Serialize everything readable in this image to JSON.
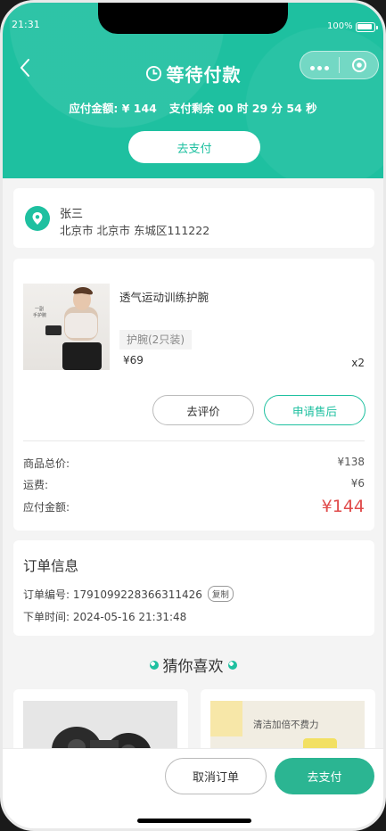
{
  "status_bar": {
    "time": "21:31",
    "battery": "100%"
  },
  "header": {
    "title": "等待付款",
    "amount_label": "应付金额: ¥ 144",
    "countdown_label": "支付剩余 00 时 29 分 54 秒",
    "pay_button": "去支付",
    "accent_color": "#1ec0a0"
  },
  "address": {
    "name": "张三",
    "detail": "北京市 北京市 东城区111222"
  },
  "goods": {
    "name": "透气运动训练护腕",
    "spec": "护腕(2只装)",
    "price": "¥69",
    "qty": "x2",
    "thumb_text_1": "一副",
    "thumb_text_2": "手护腕",
    "review_button": "去评价",
    "after_sale_button": "申请售后",
    "summary": [
      {
        "label": "商品总价:",
        "value": "¥138"
      },
      {
        "label": "运费:",
        "value": "¥6"
      },
      {
        "label": "应付金额:",
        "value": "¥144"
      }
    ]
  },
  "order_info": {
    "title": "订单信息",
    "order_no_label": "订单编号: 1791099228366311426",
    "copy_label": "复制",
    "time_label": "下单时间: 2024-05-16 21:31:48"
  },
  "recommend": {
    "title": "猜你喜欢",
    "item2_caption": "清洁加倍不费力"
  },
  "bottom_bar": {
    "cancel_button": "取消订单",
    "pay_button": "去支付"
  }
}
